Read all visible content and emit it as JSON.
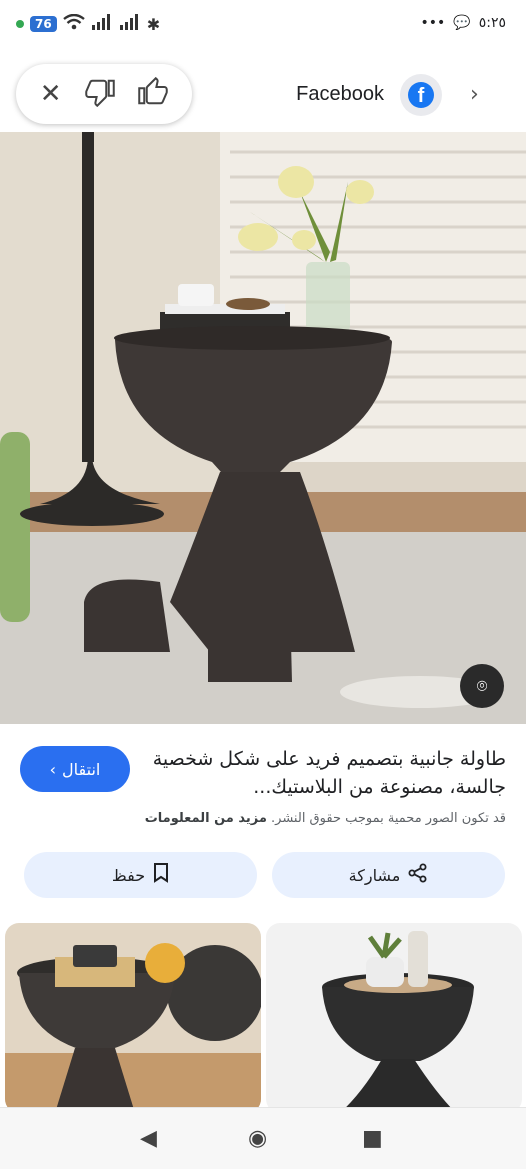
{
  "status": {
    "battery": "76",
    "time": "٥:٢٥"
  },
  "topbar": {
    "source_name": "Facebook"
  },
  "result": {
    "title": "طاولة جانبية بتصميم فريد على شكل شخصية جالسة، مصنوعة من البلاستيك...",
    "copyright_note": "قد تكون الصور محمية بموجب حقوق النشر.",
    "more_info": "مزيد من المعلومات",
    "visit_label": "انتقال",
    "share_label": "مشاركة",
    "save_label": "حفظ"
  },
  "colors": {
    "accent": "#2a6ff0",
    "facebook": "#1877f2",
    "chip_bg": "#e8f0fe"
  }
}
